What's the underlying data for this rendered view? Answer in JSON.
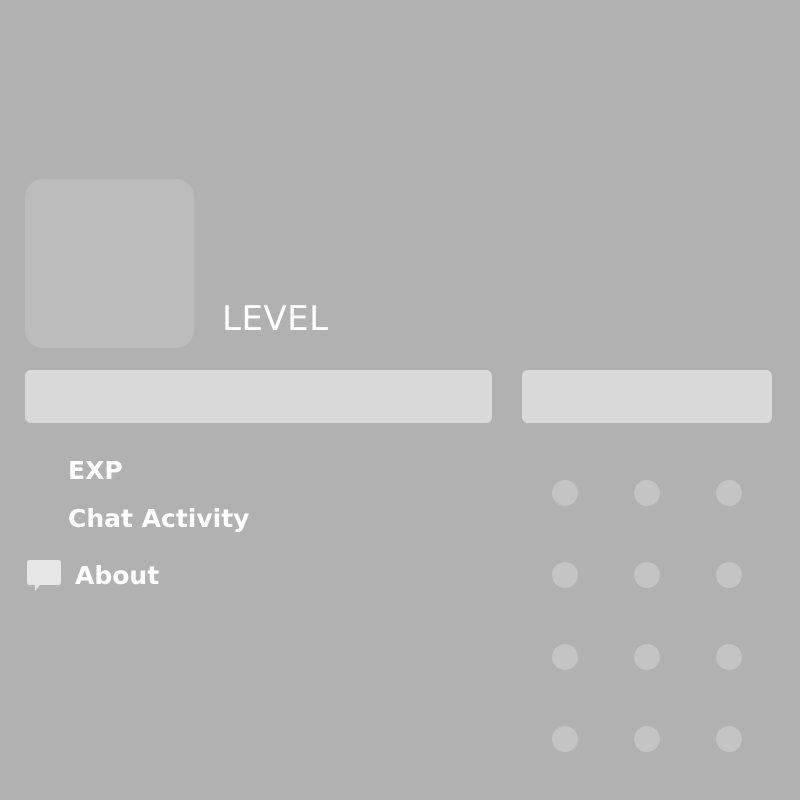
{
  "profile": {
    "level_label": "LEVEL",
    "stats": {
      "exp_label": "EXP",
      "chat_activity_label": "Chat Activity"
    },
    "about": {
      "icon": "chat-bubble-icon",
      "label": "About"
    }
  },
  "colors": {
    "background": "#b1b1b1",
    "avatar_placeholder": "#bcbcbc",
    "bar_placeholder": "#d9d9d9",
    "dot": "#c4c4c4",
    "text": "#ffffff"
  }
}
